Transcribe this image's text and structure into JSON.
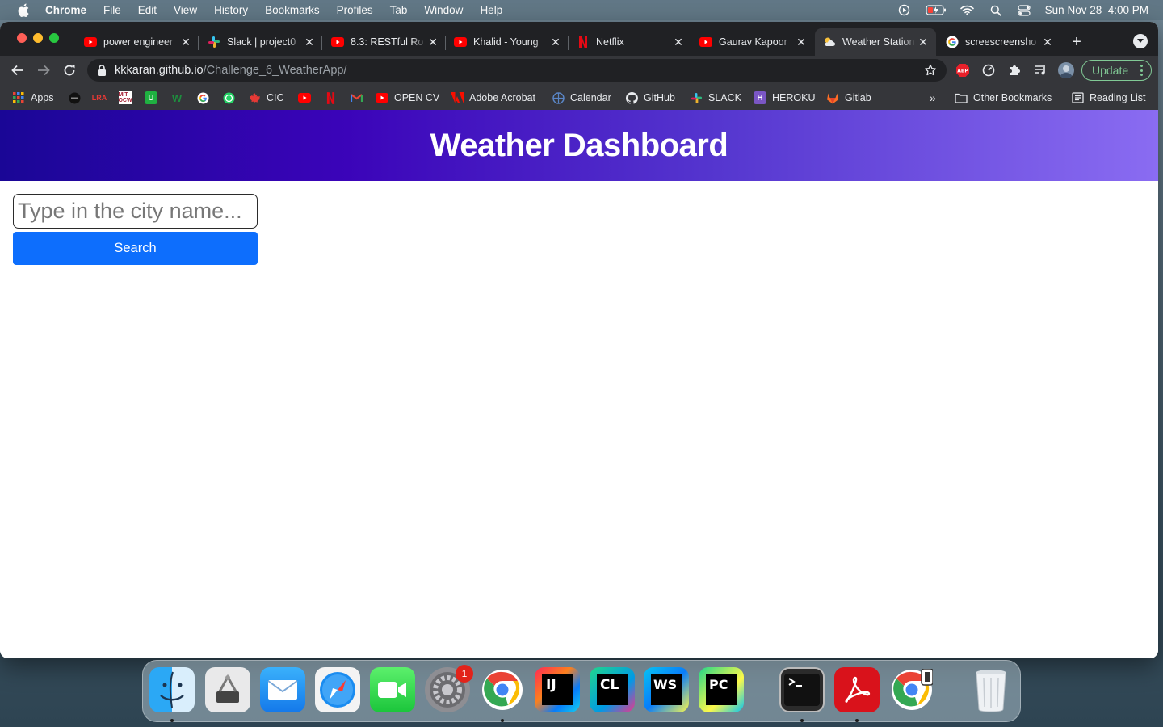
{
  "menubar": {
    "app_name": "Chrome",
    "items": [
      "File",
      "Edit",
      "View",
      "History",
      "Bookmarks",
      "Profiles",
      "Tab",
      "Window",
      "Help"
    ],
    "datetime": "Sun Nov 28  4:00 PM"
  },
  "tabs": [
    {
      "title": "power engineer",
      "icon": "youtube-icon",
      "active": false
    },
    {
      "title": "Slack | project0",
      "icon": "slack-icon",
      "active": false
    },
    {
      "title": "8.3: RESTful Ro",
      "icon": "youtube-icon",
      "active": false
    },
    {
      "title": "Khalid - Young",
      "icon": "youtube-icon",
      "active": false
    },
    {
      "title": "Netflix",
      "icon": "netflix-icon",
      "active": false
    },
    {
      "title": "Gaurav Kapoor",
      "icon": "youtube-icon",
      "active": false
    },
    {
      "title": "Weather Station",
      "icon": "weather-icon",
      "active": true
    },
    {
      "title": "screescreensho",
      "icon": "google-icon",
      "active": false
    }
  ],
  "address_bar": {
    "host": "kkkaran.github.io",
    "path": "/Challenge_6_WeatherApp/"
  },
  "update_button": "Update",
  "bookmarks": {
    "apps": "Apps",
    "cic": "CIC",
    "open_cv": "OPEN CV",
    "adobe_acrobat": "Adobe Acrobat",
    "calendar": "Calendar",
    "github": "GitHub",
    "slack": "SLACK",
    "heroku": "HEROKU",
    "gitlab": "Gitlab",
    "more": "»",
    "other_bookmarks": "Other Bookmarks",
    "reading_list": "Reading List"
  },
  "page": {
    "title": "Weather Dashboard",
    "search_placeholder": "Type in the city name...",
    "search_value": "",
    "search_button": "Search"
  },
  "dock": {
    "apps": [
      "Finder",
      "System Information",
      "Mail",
      "Safari",
      "FaceTime",
      "System Preferences",
      "Google Chrome",
      "IntelliJ IDEA",
      "CLion",
      "WebStorm",
      "PyCharm",
      "Terminal",
      "Adobe Acrobat",
      "Chrome Apps",
      "Trash"
    ],
    "system_preferences_badge": "1"
  },
  "colors": {
    "header_gradient": [
      "#1a0696",
      "#3b04b9",
      "#5536cf",
      "#8a6cf2"
    ],
    "search_button": "#0d6efd",
    "update_accent": "#81c995",
    "tabstrip": "#202124",
    "toolbar": "#35363a"
  }
}
